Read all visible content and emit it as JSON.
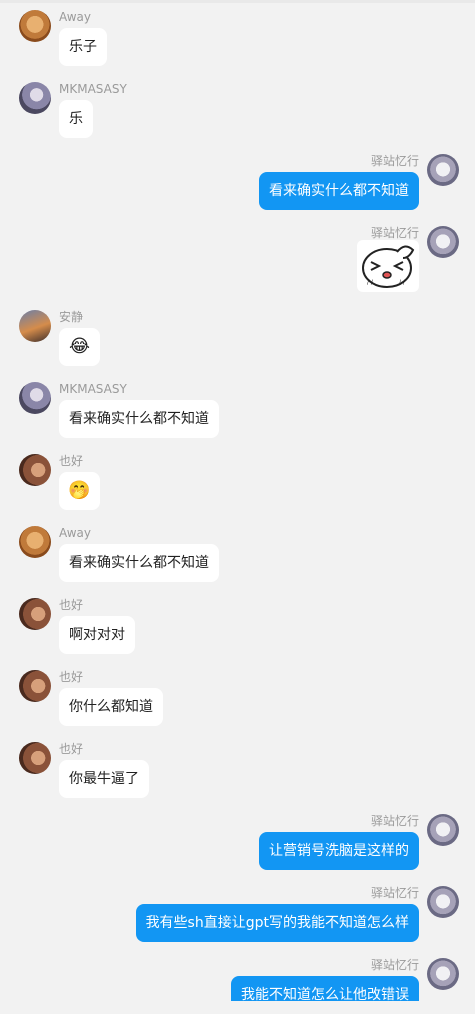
{
  "chat": {
    "messages": [
      {
        "side": "left",
        "name": "Away",
        "text": "乐子",
        "avatar": "dog-avatar"
      },
      {
        "side": "left",
        "name": "MKMASASY",
        "text": "乐",
        "avatar": "anime-avatar"
      },
      {
        "side": "right",
        "name": "驿站忆行",
        "text": "看来确实什么都不知道",
        "avatar": "cat-avatar"
      },
      {
        "side": "right",
        "name": "驿站忆行",
        "text": "",
        "avatar": "cat-avatar",
        "sticker": "laughing-bunny-sticker"
      },
      {
        "side": "left",
        "name": "安静",
        "text": "😂",
        "avatar": "sunset-avatar"
      },
      {
        "side": "left",
        "name": "MKMASASY",
        "text": "看来确实什么都不知道",
        "avatar": "anime-avatar"
      },
      {
        "side": "left",
        "name": "也好",
        "text": "🤭",
        "avatar": "hair-avatar"
      },
      {
        "side": "left",
        "name": "Away",
        "text": "看来确实什么都不知道",
        "avatar": "dog-avatar"
      },
      {
        "side": "left",
        "name": "也好",
        "text": "啊对对对",
        "avatar": "hair-avatar"
      },
      {
        "side": "left",
        "name": "也好",
        "text": "你什么都知道",
        "avatar": "hair-avatar"
      },
      {
        "side": "left",
        "name": "也好",
        "text": "你最牛逼了",
        "avatar": "hair-avatar"
      },
      {
        "side": "right",
        "name": "驿站忆行",
        "text": "让营销号洗脑是这样的",
        "avatar": "cat-avatar"
      },
      {
        "side": "right",
        "name": "驿站忆行",
        "text": "我有些sh直接让gpt写的我能不知道怎么样",
        "avatar": "cat-avatar"
      },
      {
        "side": "right",
        "name": "驿站忆行",
        "text": "我能不知道怎么让他改错误",
        "avatar": "cat-avatar"
      }
    ]
  }
}
